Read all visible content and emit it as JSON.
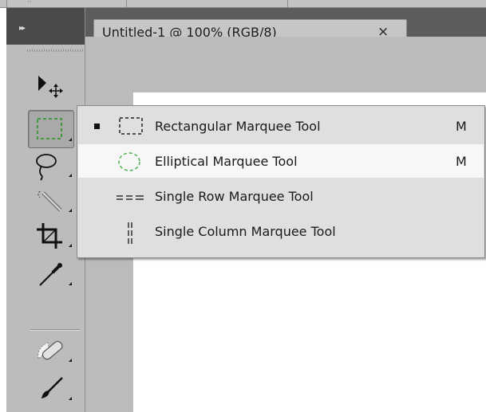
{
  "document_tab": {
    "title": "Untitled-1 @ 100% (RGB/8)",
    "close_glyph": "×"
  },
  "tools_panel": {
    "collapse_glyph": "▸▸",
    "tools": [
      {
        "name": "move-tool",
        "icon": "move-icon"
      },
      {
        "name": "rectangular-marquee-tool",
        "icon": "rect-marquee-icon",
        "selected": true
      },
      {
        "name": "lasso-tool",
        "icon": "lasso-icon"
      },
      {
        "name": "quick-selection-tool",
        "icon": "quick-select-icon"
      },
      {
        "name": "crop-tool",
        "icon": "crop-icon"
      },
      {
        "name": "eyedropper-tool",
        "icon": "eyedropper-icon"
      },
      {
        "name": "healing-brush-tool",
        "icon": "bandage-icon"
      },
      {
        "name": "brush-tool",
        "icon": "brush-icon"
      }
    ]
  },
  "flyout_menu": {
    "items": [
      {
        "label": "Rectangular Marquee Tool",
        "shortcut": "M",
        "icon": "rect-marquee-icon",
        "active": true
      },
      {
        "label": "Elliptical Marquee Tool",
        "shortcut": "M",
        "icon": "ellipse-marquee-icon",
        "hovered": true
      },
      {
        "label": "Single Row Marquee Tool",
        "shortcut": "",
        "icon": "single-row-icon"
      },
      {
        "label": "Single Column Marquee Tool",
        "shortcut": "",
        "icon": "single-column-icon"
      }
    ]
  },
  "colors": {
    "panel_bg": "#bcbcbc",
    "panel_header": "#4a4a4a",
    "tab_bar": "#5c5c5c",
    "menu_bg": "#dfdfdf",
    "menu_highlight": "#f7f7f7",
    "marquee_green": "#4caf50"
  }
}
